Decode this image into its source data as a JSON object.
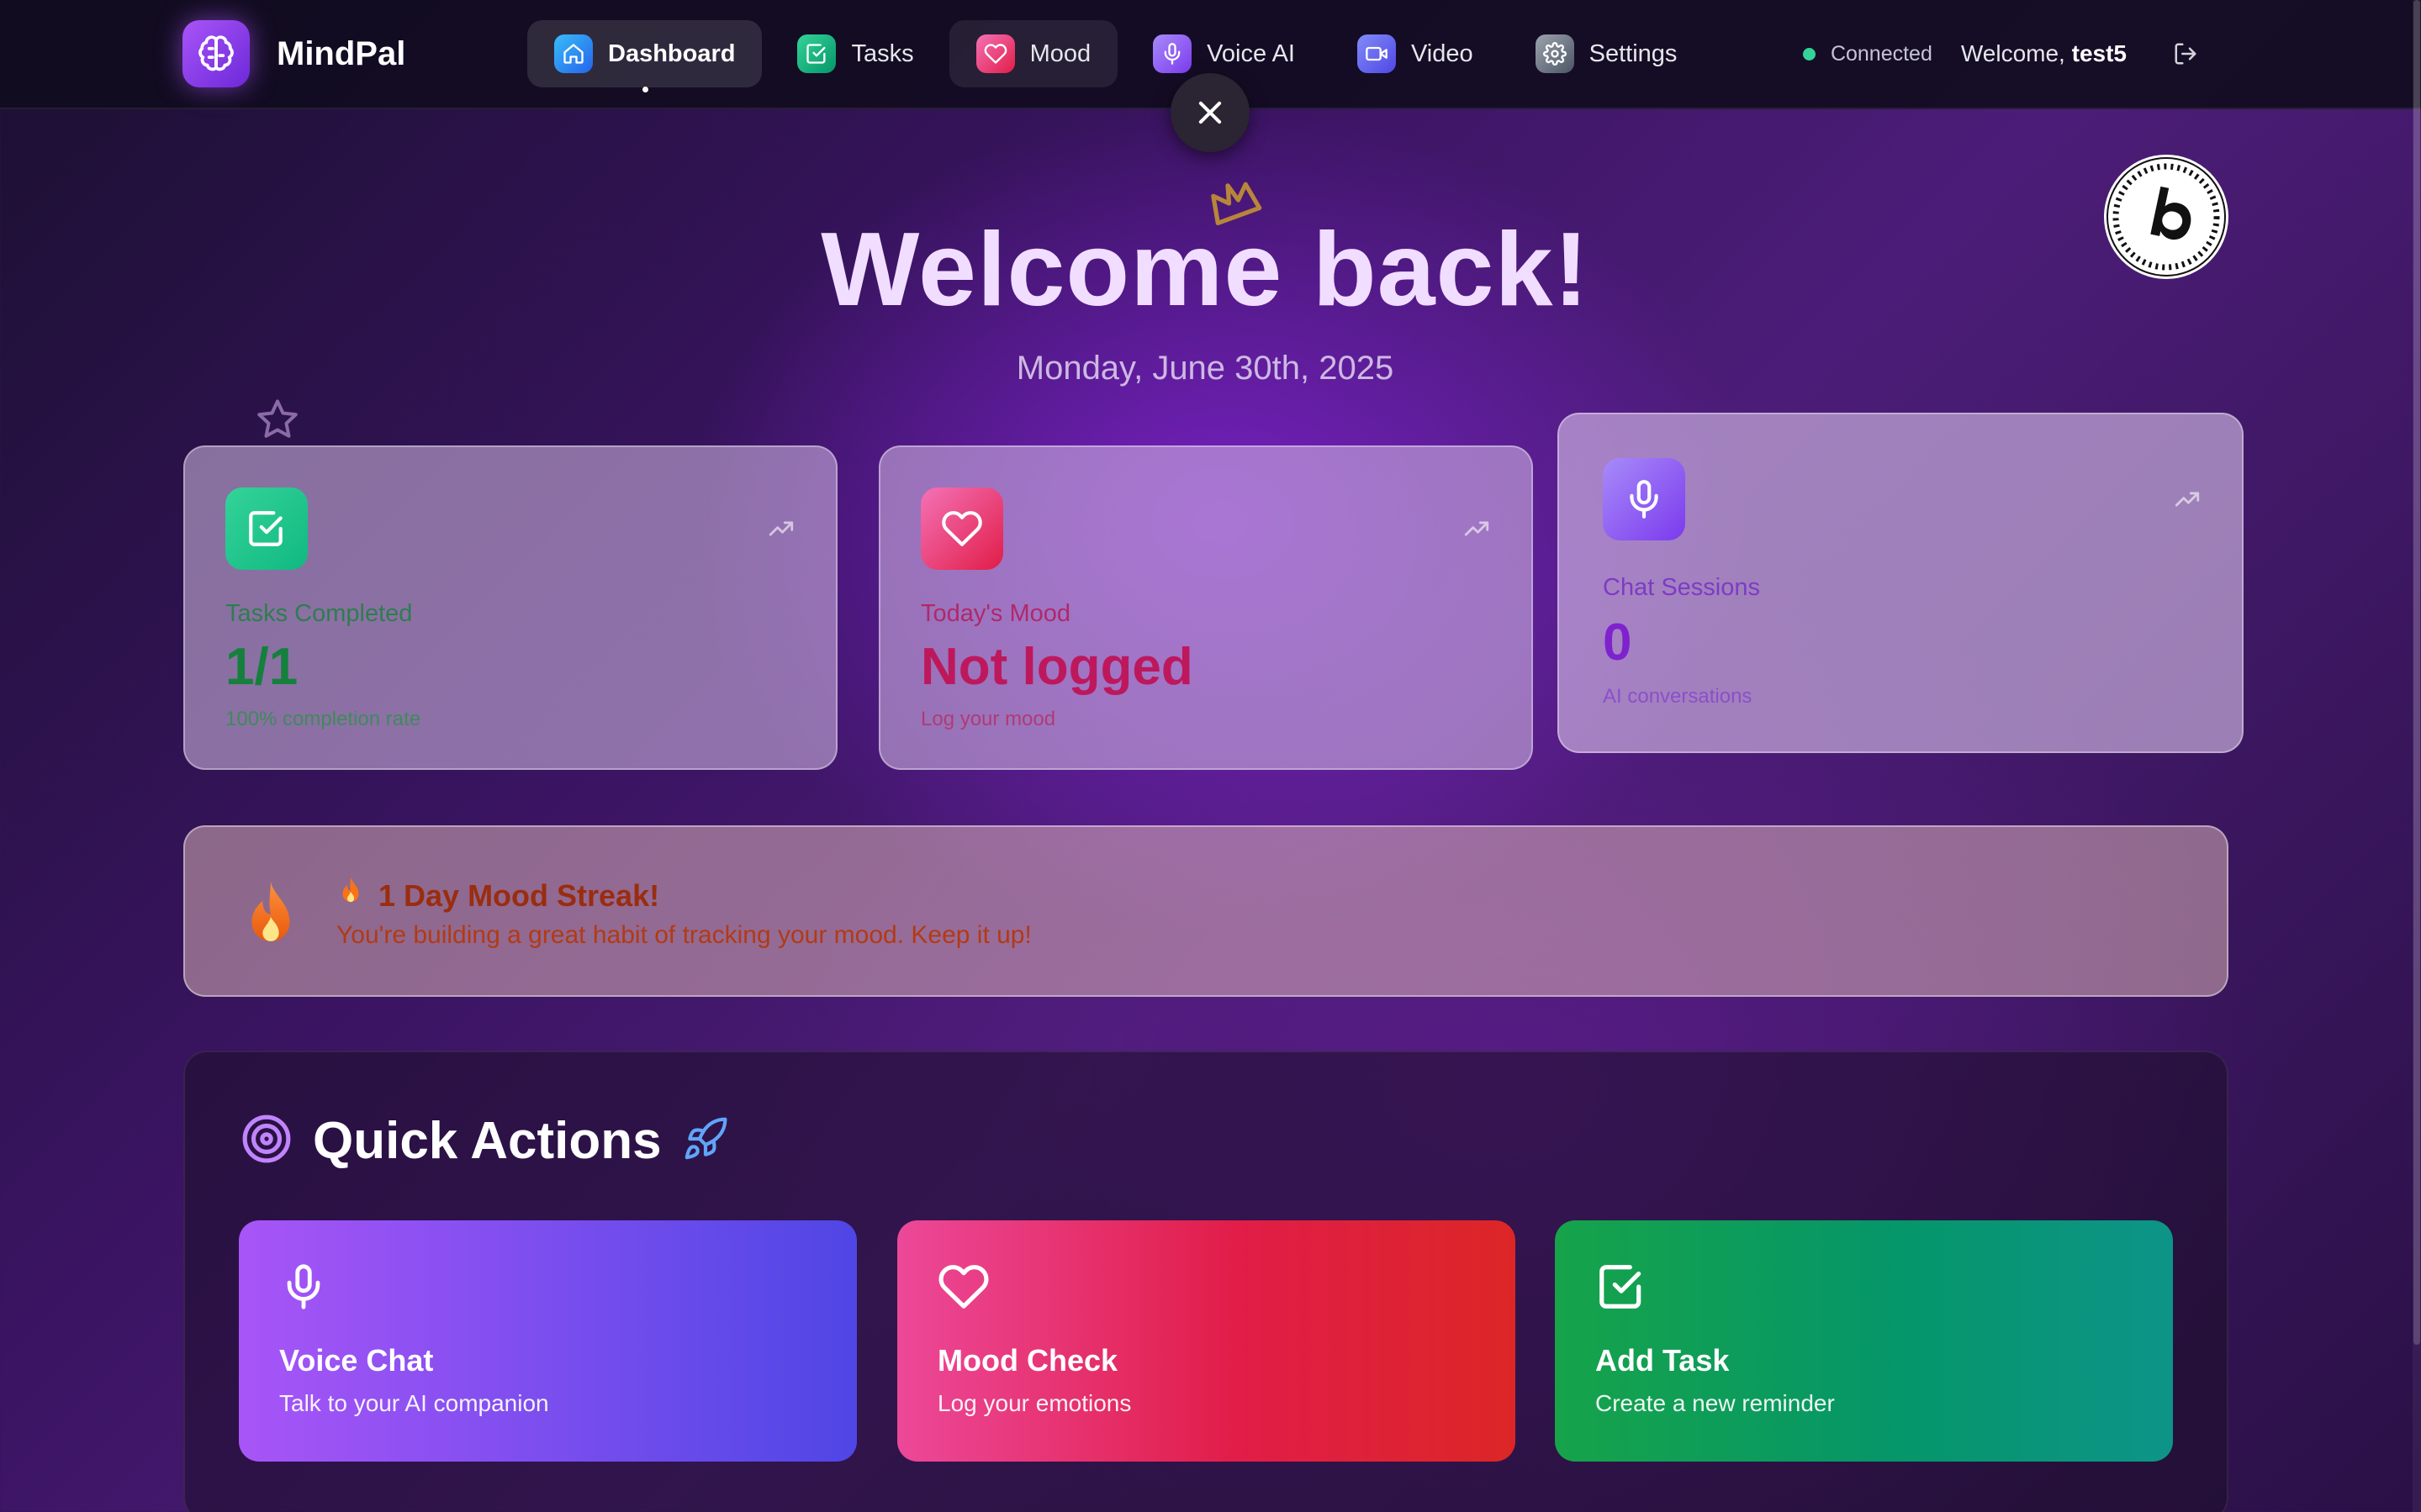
{
  "app": {
    "name": "MindPal"
  },
  "nav": {
    "items": [
      {
        "label": "Dashboard",
        "icon": "home-icon",
        "color": "#0ea5e9"
      },
      {
        "label": "Tasks",
        "icon": "check-square-icon",
        "color": "#10b981"
      },
      {
        "label": "Mood",
        "icon": "heart-icon",
        "color": "#ec4899"
      },
      {
        "label": "Voice AI",
        "icon": "mic-icon",
        "color": "#8b5cf6"
      },
      {
        "label": "Video",
        "icon": "video-icon",
        "color": "#6366f1"
      },
      {
        "label": "Settings",
        "icon": "gear-icon",
        "color": "#6b7280"
      }
    ],
    "status": "Connected",
    "welcome_prefix": "Welcome,",
    "username": "test5"
  },
  "hero": {
    "title": "Welcome back!",
    "date": "Monday, June 30th, 2025"
  },
  "stats": [
    {
      "label": "Tasks Completed",
      "value": "1/1",
      "sub": "100% completion rate",
      "icon": "check-square-icon",
      "accent": "#15803d"
    },
    {
      "label": "Today's Mood",
      "value": "Not logged",
      "sub": "Log your mood",
      "icon": "heart-icon",
      "accent": "#be185d"
    },
    {
      "label": "Chat Sessions",
      "value": "0",
      "sub": "AI conversations",
      "icon": "mic-icon",
      "accent": "#7e22ce"
    }
  ],
  "streak": {
    "title": "1 Day Mood Streak!",
    "text": "You're building a great habit of tracking your mood. Keep it up!"
  },
  "quick_actions": {
    "title": "Quick Actions",
    "items": [
      {
        "title": "Voice Chat",
        "sub": "Talk to your AI companion",
        "icon": "mic-icon"
      },
      {
        "title": "Mood Check",
        "sub": "Log your emotions",
        "icon": "heart-icon"
      },
      {
        "title": "Add Task",
        "sub": "Create a new reminder",
        "icon": "check-square-icon"
      }
    ]
  }
}
